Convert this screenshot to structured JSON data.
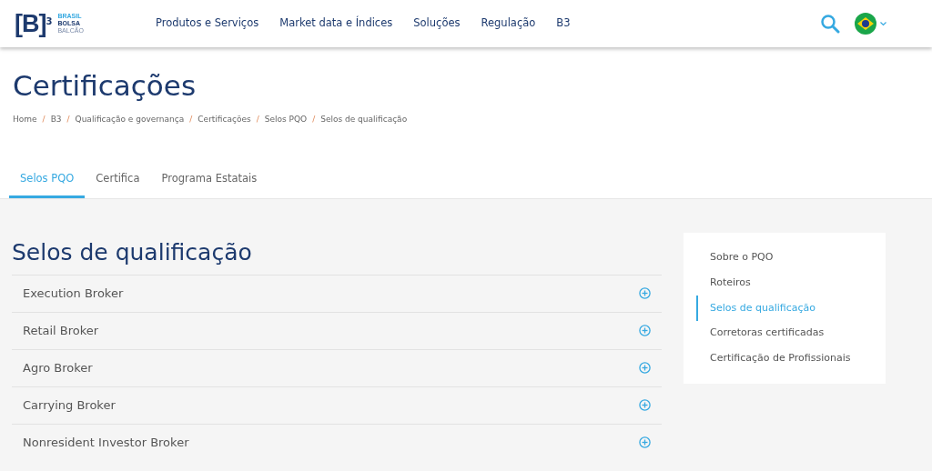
{
  "logo": {
    "mark": "[B]",
    "superscript": "3",
    "lines": [
      "BRASIL",
      "BOLSA",
      "BALCÃO"
    ]
  },
  "nav": [
    {
      "label": "Produtos e Serviços"
    },
    {
      "label": "Market data e Índices"
    },
    {
      "label": "Soluções"
    },
    {
      "label": "Regulação"
    },
    {
      "label": "B3"
    }
  ],
  "title": "Certificações",
  "breadcrumb": [
    {
      "label": "Home"
    },
    {
      "separator": "/",
      "label": "B3"
    },
    {
      "separator": "/",
      "label": "Qualificação e governança"
    },
    {
      "separator": "/",
      "label": "Certificações"
    },
    {
      "separator": "/",
      "label": "Selos PQO"
    },
    {
      "separator": "/",
      "label": "Selos de qualificação"
    }
  ],
  "tabs": [
    {
      "label": "Selos PQO",
      "selected": true
    },
    {
      "label": "Certifica",
      "selected": false
    },
    {
      "label": "Programa Estatais",
      "selected": false
    }
  ],
  "section_title": "Selos de qualificação",
  "accordion": [
    {
      "label": "Execution Broker",
      "expanded": false
    },
    {
      "label": "Retail Broker",
      "expanded": false
    },
    {
      "label": "Agro Broker",
      "expanded": false
    },
    {
      "label": "Carrying Broker",
      "expanded": false
    },
    {
      "label": "Nonresident Investor Broker",
      "expanded": false
    }
  ],
  "side_menu": [
    {
      "label": "Sobre o PQO",
      "selected": false
    },
    {
      "label": "Roteiros",
      "selected": false
    },
    {
      "label": "Selos de qualificação",
      "selected": true
    },
    {
      "label": "Corretoras certificadas",
      "selected": false
    },
    {
      "label": "Certificação de Profissionais",
      "selected": false
    }
  ]
}
